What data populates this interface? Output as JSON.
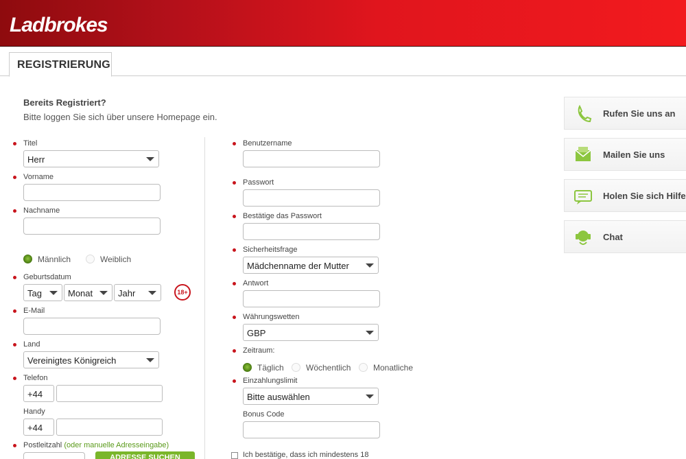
{
  "header": {
    "logo": "Ladbrokes"
  },
  "tabs": [
    {
      "label": "REGISTRIERUNG"
    }
  ],
  "intro": {
    "already": "Bereits Registriert?",
    "hint": "Bitte loggen Sie sich über unsere Homepage ein."
  },
  "left": {
    "title": {
      "label": "Titel",
      "value": "Herr"
    },
    "first_name": {
      "label": "Vorname",
      "value": ""
    },
    "last_name": {
      "label": "Nachname",
      "value": ""
    },
    "gender": {
      "male": "Männlich",
      "female": "Weiblich",
      "selected": "Männlich"
    },
    "dob": {
      "label": "Geburtsdatum",
      "day": "Tag",
      "month": "Monat",
      "year": "Jahr",
      "badge": "18+"
    },
    "email": {
      "label": "E-Mail",
      "value": ""
    },
    "country": {
      "label": "Land",
      "value": "Vereinigtes Königreich"
    },
    "phone": {
      "label": "Telefon",
      "prefix": "+44",
      "value": ""
    },
    "mobile": {
      "label": "Handy",
      "prefix": "+44",
      "value": ""
    },
    "postcode": {
      "label": "Postleitzahl",
      "manual_link": "(oder manuelle Adresseingabe)",
      "button": "ADRESSE SUCHEN"
    }
  },
  "right": {
    "username": {
      "label": "Benutzername",
      "value": ""
    },
    "password": {
      "label": "Passwort",
      "value": ""
    },
    "confirm_password": {
      "label": "Bestätige das Passwort",
      "value": ""
    },
    "security_question": {
      "label": "Sicherheitsfrage",
      "value": "Mädchenname der Mutter"
    },
    "answer": {
      "label": "Antwort",
      "value": ""
    },
    "currency": {
      "label": "Währungswetten",
      "value": "GBP"
    },
    "period": {
      "label": "Zeitraum:",
      "daily": "Täglich",
      "weekly": "Wöchentlich",
      "monthly": "Monatliche",
      "selected": "Täglich"
    },
    "deposit_limit": {
      "label": "Einzahlungslimit",
      "value": "Bitte auswählen"
    },
    "bonus": {
      "label": "Bonus Code",
      "value": ""
    },
    "confirm_age": "Ich bestätige, dass ich mindestens 18"
  },
  "help": [
    {
      "label": "Rufen Sie uns an",
      "icon": "phone-icon"
    },
    {
      "label": "Mailen Sie uns",
      "icon": "envelope-icon"
    },
    {
      "label": "Holen Sie sich Hilfe",
      "icon": "message-icon"
    },
    {
      "label": "Chat",
      "icon": "headset-icon"
    }
  ],
  "colors": {
    "brand_red": "#e0151d",
    "required_dot": "#c8141c",
    "accent_green": "#7ab62a"
  }
}
